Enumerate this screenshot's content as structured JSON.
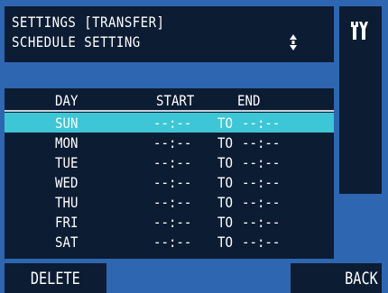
{
  "header": {
    "title_line1": "SETTINGS [TRANSFER]",
    "title_line2": "SCHEDULE SETTING",
    "scroll_icon": "up-down-arrows-icon"
  },
  "side_panel": {
    "icon": "tools-icon"
  },
  "table": {
    "columns": {
      "day": "DAY",
      "start": "START",
      "end": "END"
    },
    "separator": "TO",
    "rows": [
      {
        "day": "SUN",
        "start": "--:--",
        "end": "--:--",
        "selected": true
      },
      {
        "day": "MON",
        "start": "--:--",
        "end": "--:--"
      },
      {
        "day": "TUE",
        "start": "--:--",
        "end": "--:--"
      },
      {
        "day": "WED",
        "start": "--:--",
        "end": "--:--"
      },
      {
        "day": "THU",
        "start": "--:--",
        "end": "--:--"
      },
      {
        "day": "FRI",
        "start": "--:--",
        "end": "--:--"
      },
      {
        "day": "SAT",
        "start": "--:--",
        "end": "--:--"
      }
    ]
  },
  "softkeys": {
    "left": "DELETE",
    "right": "BACK"
  },
  "colors": {
    "background": "#2f66b2",
    "panel": "#0c1c33",
    "selection": "#3cc6d6"
  }
}
